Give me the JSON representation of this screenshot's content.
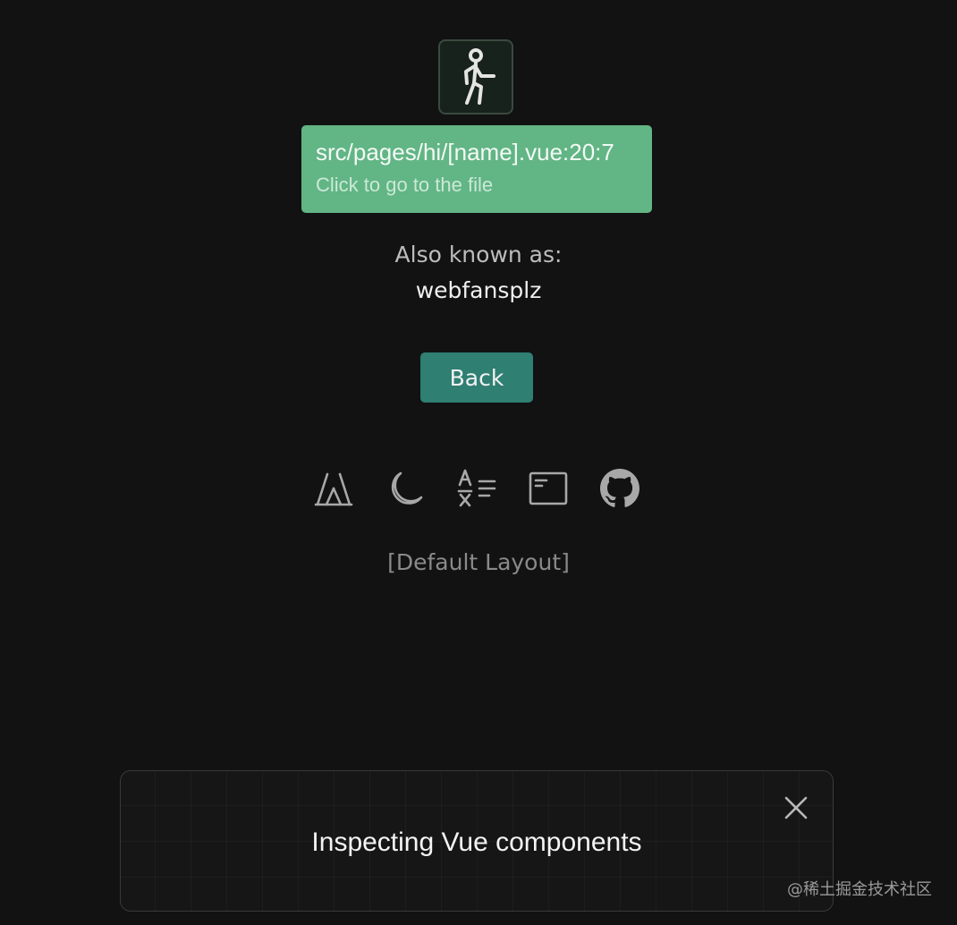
{
  "hero": {
    "icon": "walking-person-icon"
  },
  "tooltip": {
    "file_path": "src/pages/hi/[name].vue:20:7",
    "hint": "Click to go to the file"
  },
  "main": {
    "also_known_label": "Also known as:",
    "name": "webfansplz",
    "back_label": "Back"
  },
  "footer": {
    "icons": [
      "tent-icon",
      "moon-icon",
      "translate-icon",
      "browser-window-icon",
      "github-icon"
    ],
    "layout_label": "[Default Layout]"
  },
  "toast": {
    "message": "Inspecting Vue components",
    "close_icon": "close-icon"
  },
  "watermark": {
    "text": "@稀土掘金技术社区"
  },
  "colors": {
    "background": "#121212",
    "tooltip": "#62b585",
    "button": "#2f7f73",
    "icon": "#a8a8a8"
  }
}
